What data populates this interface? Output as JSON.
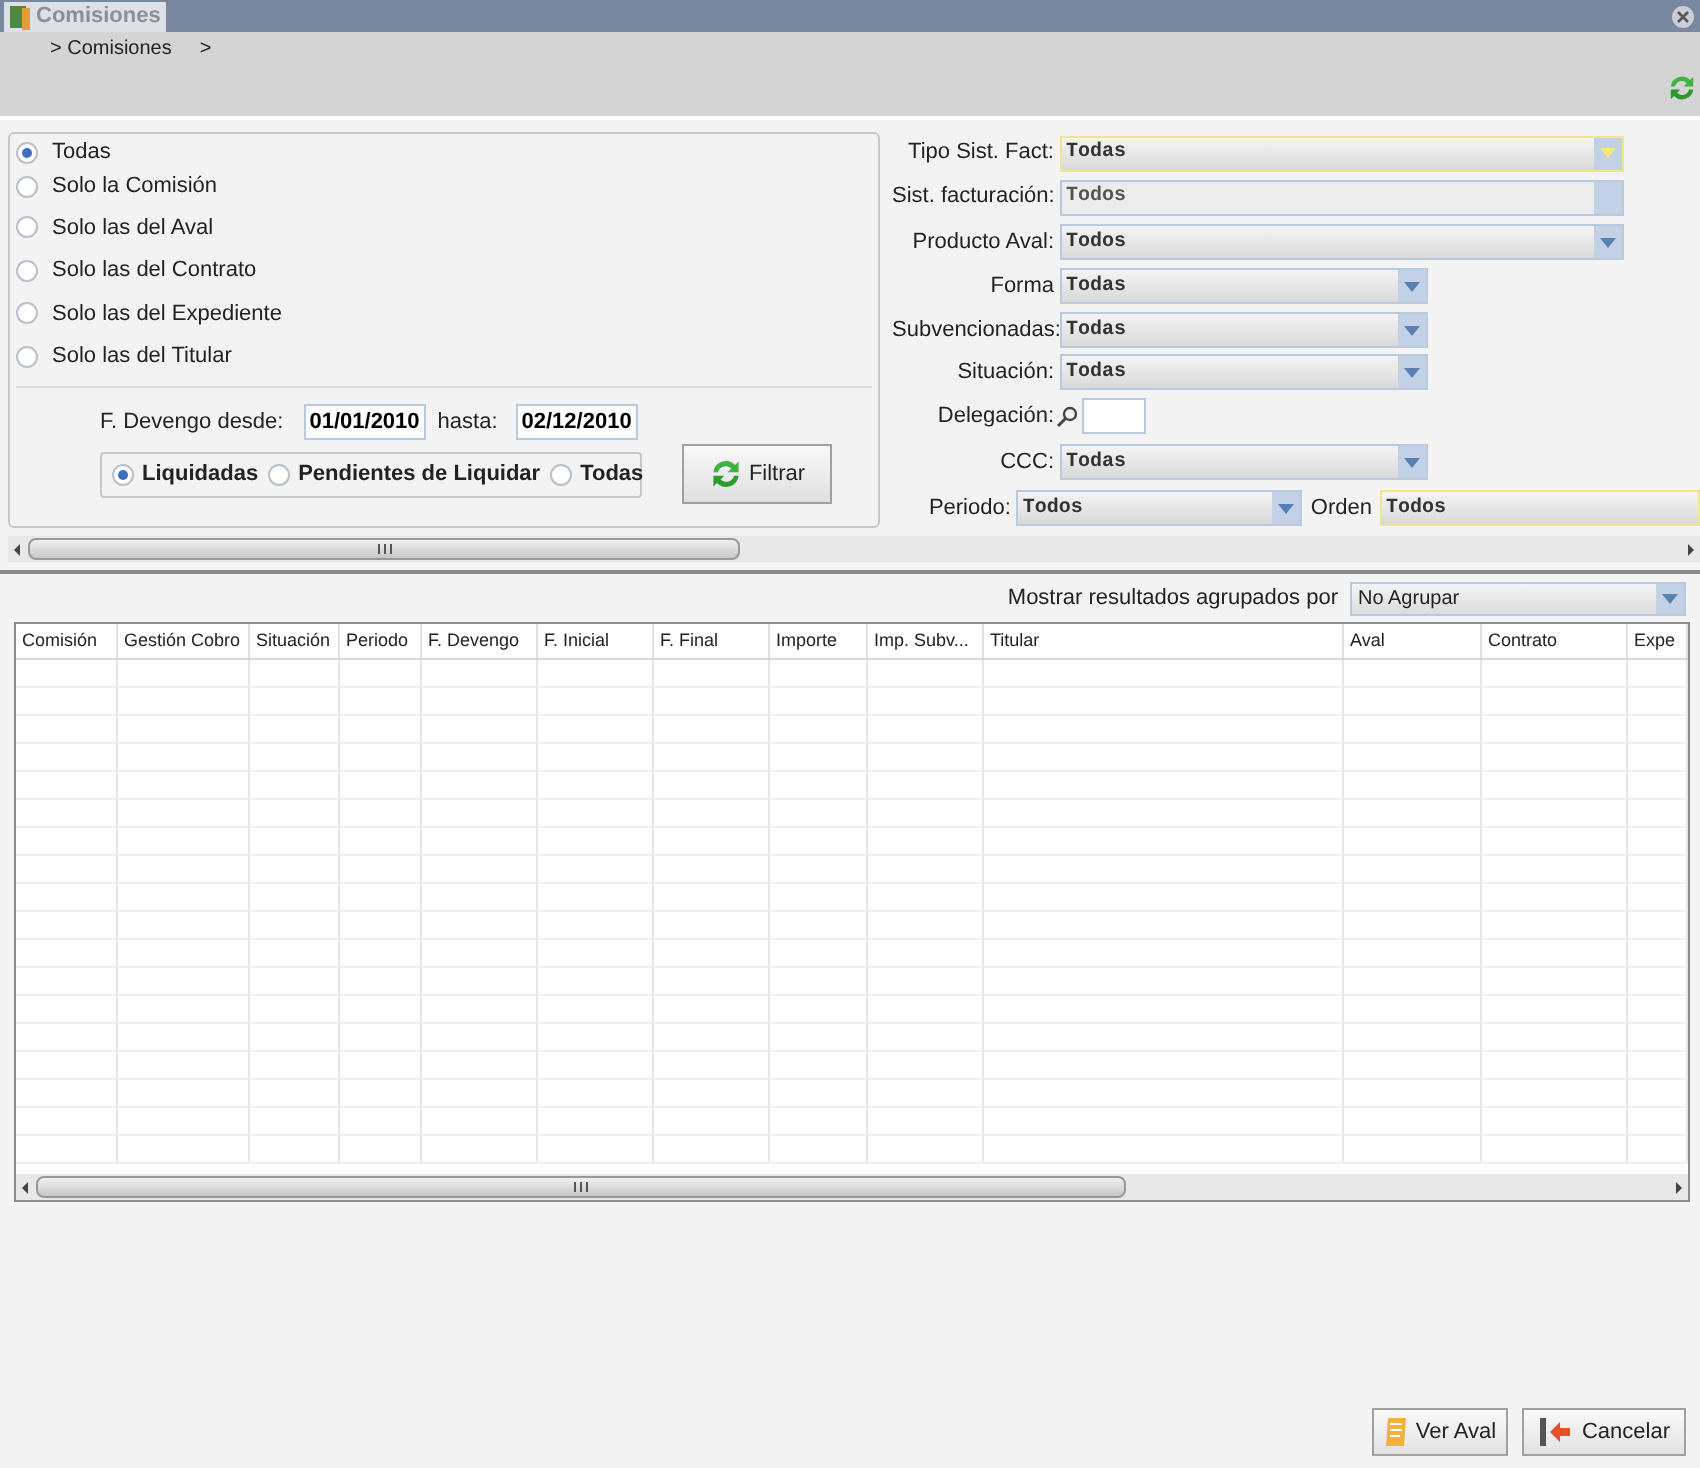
{
  "window": {
    "title": "Comisiones"
  },
  "breadcrumb": [
    "> Comisiones",
    ">"
  ],
  "scope_options": [
    {
      "label": "Todas",
      "selected": true
    },
    {
      "label": "Solo la Comisión",
      "selected": false
    },
    {
      "label": "Solo las del Aval",
      "selected": false
    },
    {
      "label": "Solo las del Contrato",
      "selected": false
    },
    {
      "label": "Solo las del Expediente",
      "selected": false
    },
    {
      "label": "Solo las del Titular",
      "selected": false
    }
  ],
  "dates": {
    "from_label": "F. Devengo desde:",
    "from": "01/01/2010",
    "to_label": "hasta:",
    "to": "02/12/2010"
  },
  "status_options": [
    {
      "label": "Liquidadas",
      "selected": true
    },
    {
      "label": "Pendientes de Liquidar",
      "selected": false
    },
    {
      "label": "Todas",
      "selected": false
    }
  ],
  "filter_button": "Filtrar",
  "fields": [
    {
      "kind": "dropdown",
      "label": "Tipo Sist. Fact:",
      "value": "Todas",
      "focused": true,
      "disabled": false
    },
    {
      "kind": "dropdown",
      "label": "Sist. facturación:",
      "value": "Todos",
      "focused": false,
      "disabled": true
    },
    {
      "kind": "dropdown",
      "label": "Producto Aval:",
      "value": "Todos",
      "focused": false,
      "disabled": false
    },
    {
      "kind": "dropdown",
      "label": "Forma",
      "value": "Todas",
      "focused": false,
      "disabled": false
    },
    {
      "kind": "dropdown",
      "label": "Subvencionadas:",
      "value": "Todas",
      "focused": false,
      "disabled": false
    },
    {
      "kind": "dropdown",
      "label": "Situación:",
      "value": "Todas",
      "focused": false,
      "disabled": false
    },
    {
      "kind": "lookup",
      "label": "Delegación:"
    },
    {
      "kind": "dropdown",
      "label": "CCC:",
      "value": "Todas",
      "focused": false,
      "disabled": false
    },
    {
      "kind": "pair",
      "label": "Periodo:",
      "value": "Todos",
      "focused": false,
      "disabled": false,
      "second_label": "Orden",
      "second_value": "Todos",
      "second_focused": true
    }
  ],
  "group_by": {
    "label": "Mostrar resultados agrupados por",
    "value": "No Agrupar"
  },
  "table": {
    "columns": [
      "Comisión",
      "Gestión Cobro",
      "Situación",
      "Periodo",
      "F. Devengo",
      "F. Inicial",
      "F. Final",
      "Importe",
      "Imp. Subv...",
      "Titular",
      "Aval",
      "Contrato",
      "Expe"
    ]
  },
  "buttons": [
    {
      "kind": "view",
      "label": "Ver Aval"
    },
    {
      "kind": "cancel",
      "label": "Cancelar"
    }
  ]
}
